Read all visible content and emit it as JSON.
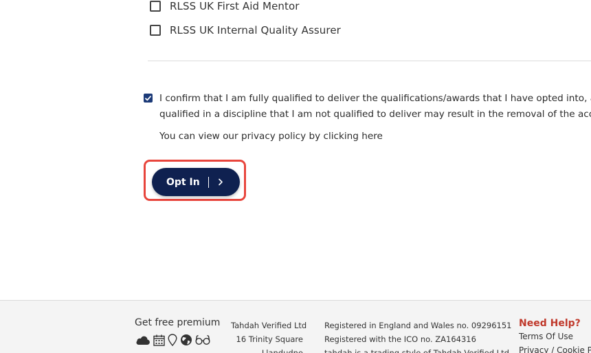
{
  "roles": [
    {
      "label": "RLSS UK First Aid Mentor",
      "checked": false
    },
    {
      "label": "RLSS UK Internal Quality Assurer",
      "checked": false
    }
  ],
  "confirm": {
    "checked": true,
    "line1": "I confirm that I am fully qualified to deliver the qualifications/awards that I have opted into, and",
    "line2": "qualified in a discipline that I am not qualified to deliver may result in the removal of the accoun"
  },
  "privacy": {
    "text": "You can view our privacy policy by ",
    "link": "clicking here"
  },
  "opt_in_button": {
    "label": "Opt In"
  },
  "colors": {
    "primary": "#0f2150",
    "checkbox_checked": "#1c3a78",
    "highlight": "#e8453c",
    "help": "#c0392b",
    "footer_bg": "#f4f4f4"
  },
  "footer": {
    "premium_label": "Get free premium",
    "icons": [
      "cloud-icon",
      "calendar-icon",
      "location-pin-icon",
      "globe-icon",
      "glasses-icon"
    ],
    "address": [
      "Tahdah Verified Ltd",
      "16 Trinity Square",
      "Llandudno"
    ],
    "registration": [
      "Registered in England and Wales no. 09296151",
      "Registered with the ICO no. ZA164316",
      "tahdah is a trading style of Tahdah Verified Ltd"
    ],
    "help": {
      "title": "Need Help?",
      "links": [
        "Terms Of Use",
        "Privacy / Cookie Po"
      ]
    }
  }
}
